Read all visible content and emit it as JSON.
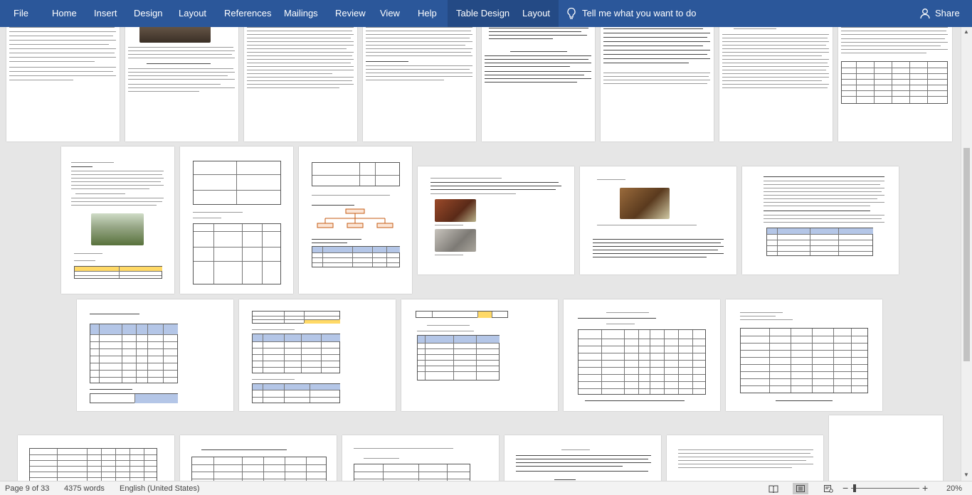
{
  "ribbon": {
    "background": "#2b579a",
    "tabs": [
      {
        "id": "file",
        "label": "File"
      },
      {
        "id": "home",
        "label": "Home"
      },
      {
        "id": "insert",
        "label": "Insert"
      },
      {
        "id": "design",
        "label": "Design"
      },
      {
        "id": "layout",
        "label": "Layout"
      },
      {
        "id": "references",
        "label": "References"
      },
      {
        "id": "mailings",
        "label": "Mailings"
      },
      {
        "id": "review",
        "label": "Review"
      },
      {
        "id": "view",
        "label": "View"
      },
      {
        "id": "help",
        "label": "Help"
      },
      {
        "id": "table-design",
        "label": "Table Design"
      },
      {
        "id": "table-layout",
        "label": "Layout"
      }
    ],
    "tell_me": {
      "icon": "lightbulb-icon",
      "label": "Tell me what you want to do"
    },
    "share": {
      "icon": "person-icon",
      "label": "Share"
    }
  },
  "status": {
    "page": "Page 9 of 33",
    "words": "4375 words",
    "language": "English (United States)",
    "zoom": "20%",
    "zoom_minus": "−",
    "zoom_plus": "+",
    "zoom_level": 0.2,
    "views": [
      {
        "id": "read-mode",
        "icon": "book-icon"
      },
      {
        "id": "print-layout",
        "icon": "page-icon",
        "active": true
      },
      {
        "id": "web-layout",
        "icon": "web-icon"
      }
    ]
  },
  "scrollbar": {
    "up": "▲",
    "down": "▼"
  }
}
